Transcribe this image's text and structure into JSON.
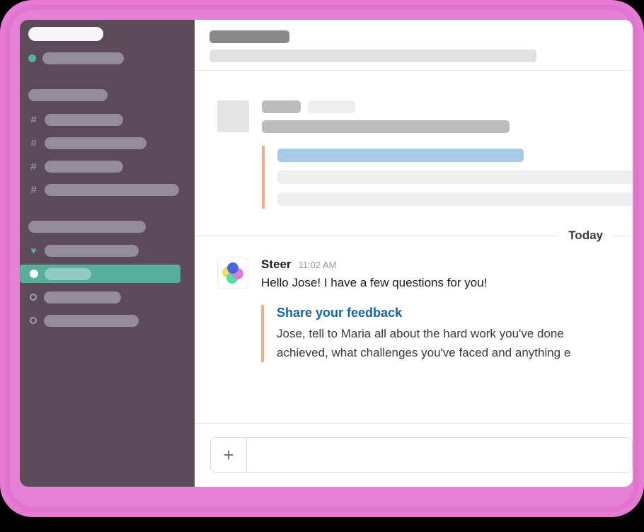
{
  "frame": {
    "accent_color": "#E77BD4"
  },
  "sidebar": {
    "background_color": "#5B4A59",
    "workspace_title_placeholder": "",
    "user_row": {
      "status_icon": "online-dot",
      "label_placeholder": ""
    },
    "section_one": {
      "header_placeholder": ""
    },
    "channels": [
      {
        "icon": "hash-icon",
        "label_placeholder": ""
      },
      {
        "icon": "hash-icon",
        "label_placeholder": ""
      },
      {
        "icon": "hash-icon",
        "label_placeholder": ""
      },
      {
        "icon": "hash-icon",
        "label_placeholder": ""
      }
    ],
    "section_two": {
      "header_placeholder": ""
    },
    "direct_messages": [
      {
        "icon": "heart-icon",
        "label_placeholder": "",
        "selected": false
      },
      {
        "icon": "filled-circle-icon",
        "label_placeholder": "",
        "selected": true
      },
      {
        "icon": "open-circle-icon",
        "label_placeholder": "",
        "selected": false
      },
      {
        "icon": "open-circle-icon",
        "label_placeholder": "",
        "selected": false
      }
    ],
    "selected_color": "#56AE9B"
  },
  "header": {
    "channel_name_placeholder": "",
    "channel_topic_placeholder": ""
  },
  "messages": {
    "skeleton": {
      "author_placeholder": "",
      "time_placeholder": "",
      "text_placeholder": "",
      "quote": {
        "accent_color": "#F5AE88",
        "title_placeholder": "",
        "line1_placeholder": "",
        "line2_placeholder": ""
      }
    },
    "divider_label": "Today",
    "latest": {
      "avatar_icon": "steer-flower-avatar",
      "avatar_colors": {
        "top": "#4C63E6",
        "right": "#DD7ED6",
        "bottom": "#55DFA7",
        "left": "#F7DC62"
      },
      "author": "Steer",
      "time": "11:02 AM",
      "text": "Hello Jose! I have a few questions for you!",
      "quote": {
        "accent_color": "#F5AE88",
        "title": "Share your feedback",
        "title_color": "#1264A3",
        "line1": "Jose, tell to Maria all about the hard work you've done",
        "line2": "achieved, what challenges you've faced and anything e"
      }
    }
  },
  "composer": {
    "add_button_icon": "plus-icon",
    "add_button_label": "+",
    "input_value": "",
    "input_placeholder": ""
  }
}
